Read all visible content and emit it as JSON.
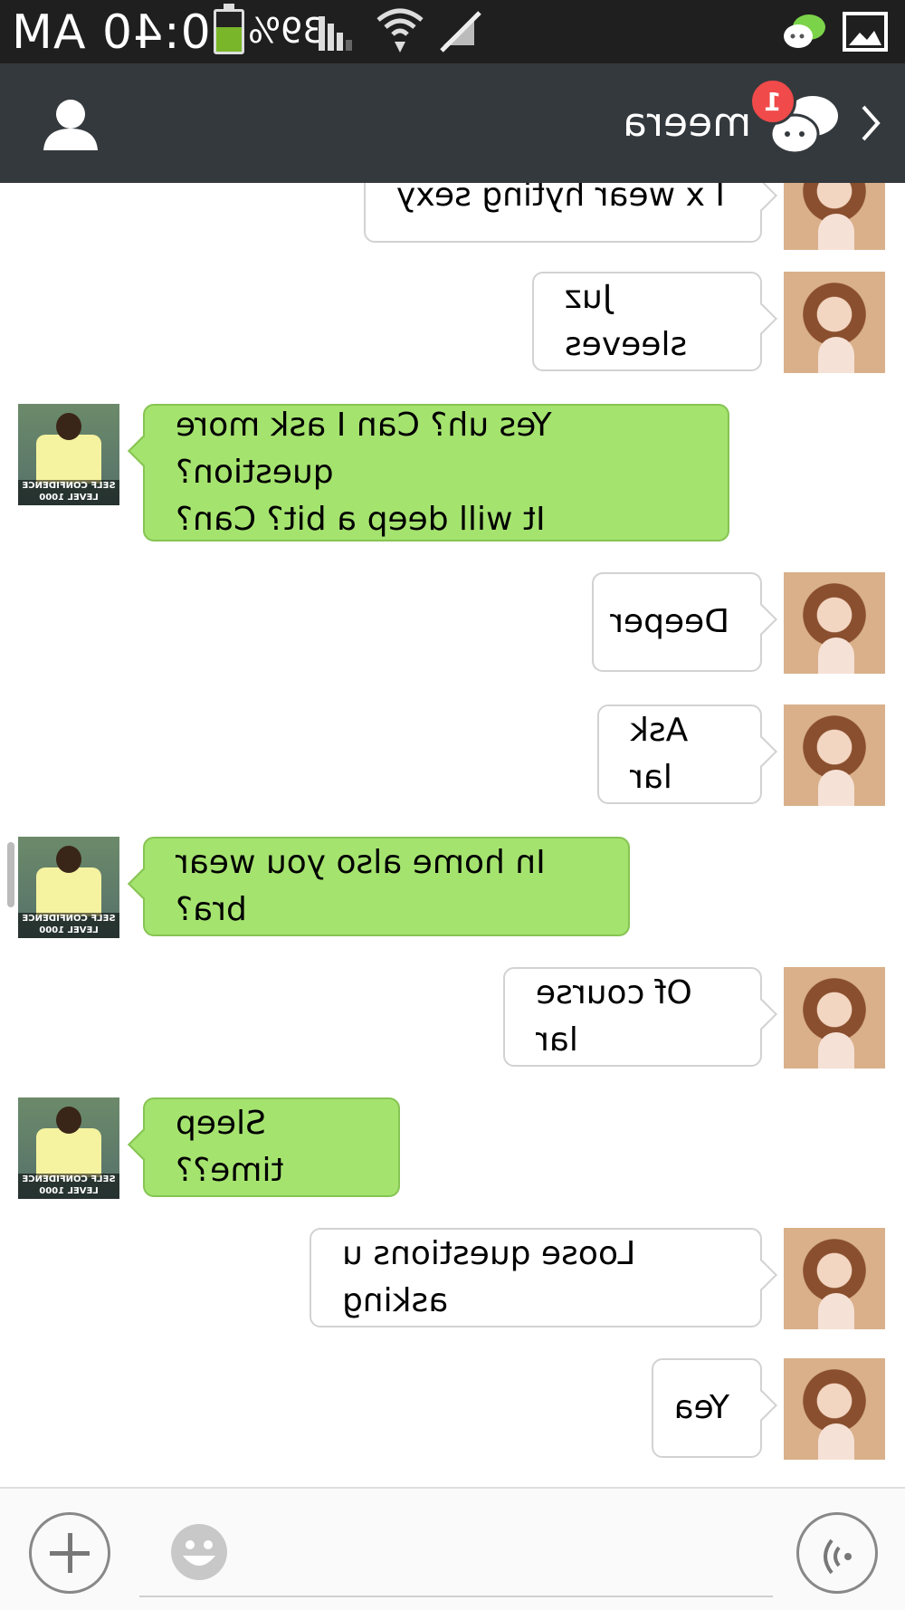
{
  "status_bar": {
    "time": "10:40 AM",
    "battery": "39%",
    "battery_level": 0.39,
    "icons": [
      "signal-icon",
      "wifi-icon",
      "sync-off-icon",
      "wechat-notification-icon",
      "gallery-icon"
    ]
  },
  "header": {
    "title": "meera",
    "unread_count": "1",
    "icons": [
      "back-chevron-icon",
      "chats-icon",
      "profile-icon"
    ]
  },
  "messages": [
    {
      "side": "incoming",
      "text": "I x wear hyting sexy"
    },
    {
      "side": "incoming",
      "text": "Juz sleeves"
    },
    {
      "side": "outgoing",
      "text": "Yes uh? Can I ask more question?\nIt will deep a bit? Can?"
    },
    {
      "side": "incoming",
      "text": "Deeper"
    },
    {
      "side": "incoming",
      "text": "Ask lar"
    },
    {
      "side": "outgoing",
      "text": "In home also you wear bra?"
    },
    {
      "side": "incoming",
      "text": "Of course lar"
    },
    {
      "side": "outgoing",
      "text": "Sleep time??"
    },
    {
      "side": "incoming",
      "text": "Loose questions u asking"
    },
    {
      "side": "incoming",
      "text": "Yea"
    }
  ],
  "avatar_caption": "SELF CONFIDENCE LEVEL 1000",
  "input_bar": {
    "message_value": "",
    "icons": [
      "plus-icon",
      "emoji-icon",
      "voice-icon"
    ]
  },
  "colors": {
    "status_bar_bg": "#1f1f1f",
    "header_bg": "#34393d",
    "outgoing_bubble": "#a5e36f",
    "incoming_bubble": "#ffffff",
    "badge": "#f04a4a",
    "battery_fill": "#7ab629"
  }
}
